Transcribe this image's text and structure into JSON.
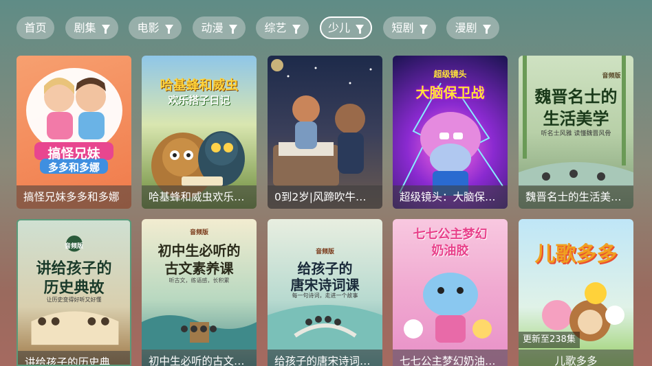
{
  "nav": {
    "tabs": [
      {
        "label": "首页"
      },
      {
        "label": "剧集"
      },
      {
        "label": "电影"
      },
      {
        "label": "动漫"
      },
      {
        "label": "综艺"
      },
      {
        "label": "少儿"
      },
      {
        "label": "短剧"
      },
      {
        "label": "漫剧"
      }
    ],
    "active": "少儿"
  },
  "cards": [
    {
      "caption": "搞怪兄妹多多和多娜",
      "poster_title": "搞怪兄妹",
      "poster_subtitle": "多多和多娜"
    },
    {
      "caption": "哈基蜂和威虫欢乐搭…",
      "poster_title": "哈基蜂和威虫",
      "poster_subtitle": "欢乐搭子日记"
    },
    {
      "caption": "0到2岁|风蹄吹牛大…"
    },
    {
      "caption": "超级镜头：大脑保卫…",
      "poster_title": "超级镜头",
      "poster_subtitle": "大脑保卫战"
    },
    {
      "caption": "魏晋名士的生活美学…",
      "poster_title": "魏晋名士的",
      "poster_subtitle": "生活美学",
      "poster_note": "听名士风雅 读懂魏晋风骨",
      "poster_tag": "音频版"
    },
    {
      "caption": "讲给孩子的历史典故…",
      "poster_title": "讲给孩子的",
      "poster_subtitle": "历史典故",
      "poster_note": "让历史变得好听又好懂",
      "poster_tag": "音频版"
    },
    {
      "caption": "初中生必听的古文素…",
      "poster_title": "初中生必听的",
      "poster_subtitle": "古文素养课",
      "poster_note": "听古文，练语感，长积累",
      "poster_tag": "音频版"
    },
    {
      "caption": "给孩子的唐宋诗词课…",
      "poster_title": "给孩子的",
      "poster_subtitle": "唐宋诗词课",
      "poster_note": "每一句诗词，走进一个故事",
      "poster_tag": "音频版"
    },
    {
      "caption": "七七公主梦幻奶油胶…",
      "poster_title": "七七公主梦幻",
      "poster_subtitle": "奶油胶"
    },
    {
      "caption": "儿歌多多",
      "poster_title": "儿歌多多",
      "badge": "更新至238集"
    }
  ],
  "colors": {
    "tab_bg": "#ffffff60",
    "caption_bg": "#3c3c3c8c"
  }
}
